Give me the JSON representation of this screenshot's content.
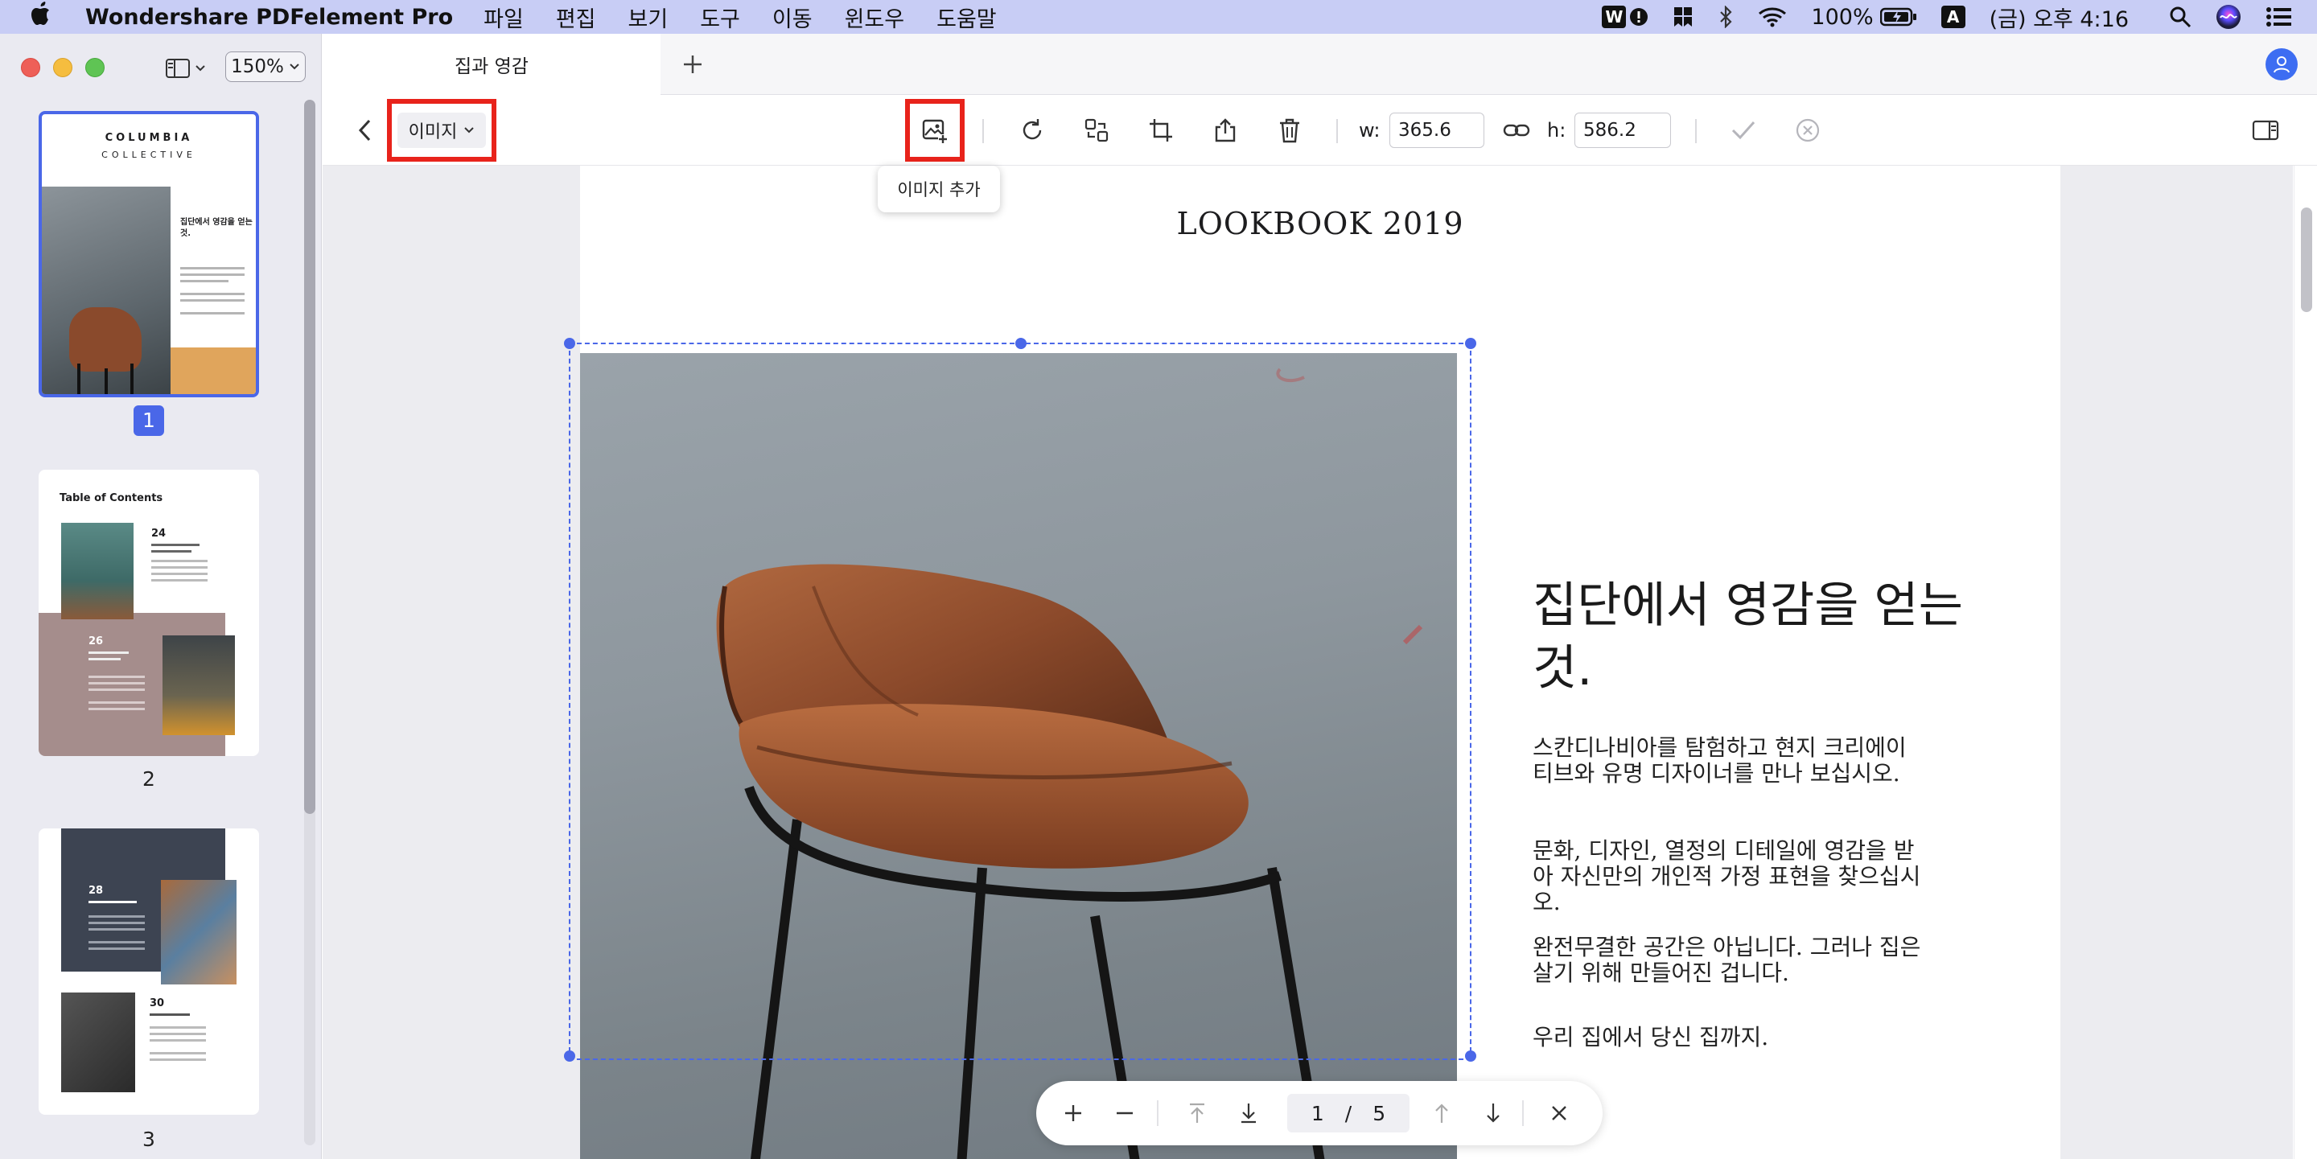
{
  "menubar": {
    "app_name": "Wondershare PDFelement Pro",
    "menus": [
      "파일",
      "편집",
      "보기",
      "도구",
      "이동",
      "윈도우",
      "도움말"
    ],
    "battery": "100%",
    "input_source": "A",
    "clock": "(금) 오후 4:16"
  },
  "sidebar": {
    "zoom": "150%",
    "pages": [
      {
        "number": "1",
        "title": "COLUMBIA",
        "subtitle": "COLLECTIVE",
        "heading": "집단에서 영감을 얻는것."
      },
      {
        "number": "2",
        "title": "Table of Contents",
        "entries": [
          {
            "num": "24"
          },
          {
            "num": "26"
          }
        ]
      },
      {
        "number": "3",
        "entries": [
          {
            "num": "28"
          },
          {
            "num": "30"
          }
        ]
      }
    ]
  },
  "tabbar": {
    "tab_title": "집과 영감",
    "new_tab": "+"
  },
  "toolbar": {
    "mode_label": "이미지",
    "tooltip": "이미지 추가",
    "w_label": "w:",
    "w_value": "365.6",
    "h_label": "h:",
    "h_value": "586.2"
  },
  "document": {
    "title": "LOOKBOOK 2019",
    "heading": "집단에서 영감을 얻는것.",
    "paragraphs": [
      "스칸디나비아를 탐험하고 현지 크리에이티브와 유명 디자이너를 만나 보십시오.",
      "문화, 디자인, 열정의 디테일에 영감을 받아 자신만의 개인적 가정 표현을 찾으십시오.",
      "완전무결한 공간은 아닙니다. 그러나 집은 살기 위해 만들어진 겁니다.",
      "우리 집에서 당신 집까지."
    ]
  },
  "page_nav": {
    "current_page": "1",
    "separator": "/",
    "total_pages": "5"
  },
  "colors": {
    "accent": "#4a67e8",
    "highlight_box": "#e8231b",
    "menubar": "#c8cdf5"
  }
}
